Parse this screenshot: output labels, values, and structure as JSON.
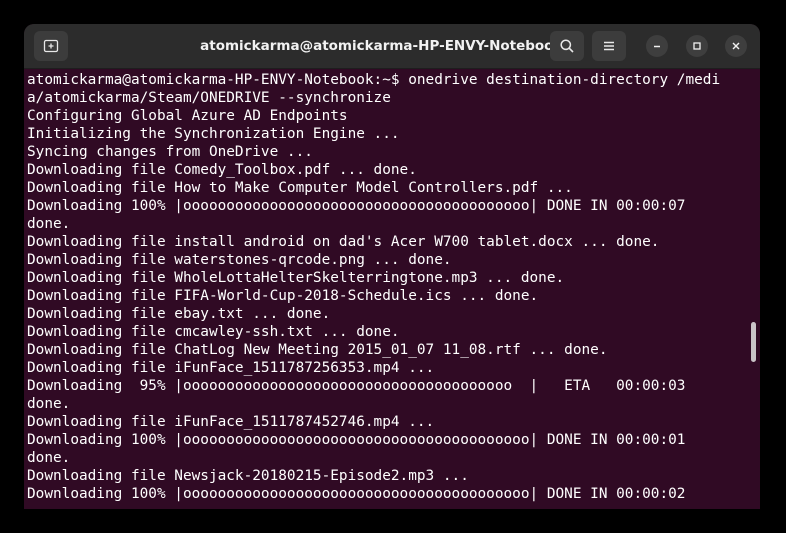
{
  "window": {
    "title": "atomickarma@atomickarma-HP-ENVY-Notebook: ~"
  },
  "icons": {
    "new_tab": "new-tab-icon",
    "search": "search-icon",
    "menu": "hamburger-menu-icon",
    "minimize": "minimize-icon",
    "maximize": "maximize-icon",
    "close": "close-icon"
  },
  "terminal": {
    "lines": [
      "atomickarma@atomickarma-HP-ENVY-Notebook:~$ onedrive destination-directory /medi",
      "a/atomickarma/Steam/ONEDRIVE --synchronize",
      "Configuring Global Azure AD Endpoints",
      "Initializing the Synchronization Engine ...",
      "Syncing changes from OneDrive ...",
      "Downloading file Comedy_Toolbox.pdf ... done.",
      "Downloading file How to Make Computer Model Controllers.pdf ...",
      "Downloading 100% |oooooooooooooooooooooooooooooooooooooooo| DONE IN 00:00:07",
      "done.",
      "Downloading file install android on dad's Acer W700 tablet.docx ... done.",
      "Downloading file waterstones-qrcode.png ... done.",
      "Downloading file WholeLottaHelterSkelterringtone.mp3 ... done.",
      "Downloading file FIFA-World-Cup-2018-Schedule.ics ... done.",
      "Downloading file ebay.txt ... done.",
      "Downloading file cmcawley-ssh.txt ... done.",
      "Downloading file ChatLog New Meeting 2015_01_07 11_08.rtf ... done.",
      "Downloading file iFunFace_1511787256353.mp4 ...",
      "Downloading  95% |oooooooooooooooooooooooooooooooooooooo  |   ETA   00:00:03",
      "done.",
      "Downloading file iFunFace_1511787452746.mp4 ...",
      "Downloading 100% |oooooooooooooooooooooooooooooooooooooooo| DONE IN 00:00:01",
      "done.",
      "Downloading file Newsjack-20180215-Episode2.mp3 ...",
      "Downloading 100% |oooooooooooooooooooooooooooooooooooooooo| DONE IN 00:00:02"
    ]
  }
}
